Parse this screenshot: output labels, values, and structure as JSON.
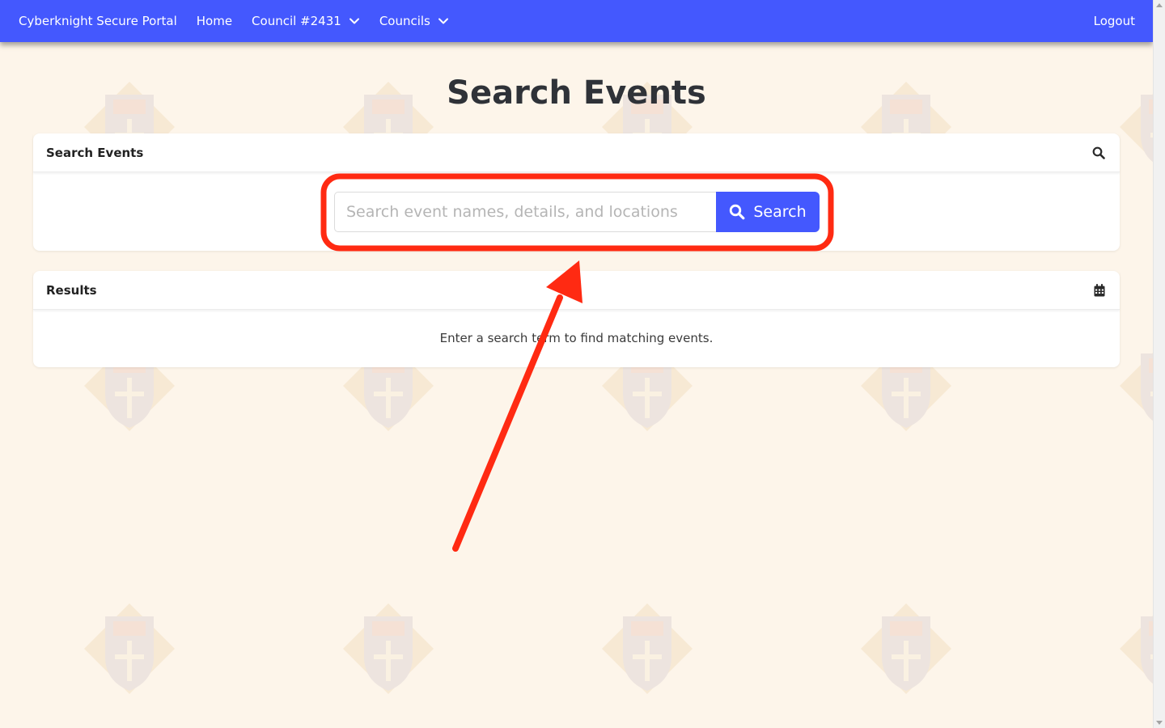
{
  "navbar": {
    "brand": "Cyberknight Secure Portal",
    "home": "Home",
    "council": "Council #2431",
    "councils": "Councils",
    "logout": "Logout"
  },
  "page": {
    "title": "Search Events"
  },
  "search_card": {
    "title": "Search Events",
    "header_icon": "search-icon",
    "input_placeholder": "Search event names, details, and locations",
    "input_value": "",
    "button_label": "Search",
    "button_icon": "search-icon"
  },
  "results_card": {
    "title": "Results",
    "header_icon": "calendar-icon",
    "empty_message": "Enter a search term to find matching events."
  },
  "colors": {
    "accent": "#4458fe",
    "background": "#fdf5ea",
    "annotation": "#ff2a12"
  }
}
